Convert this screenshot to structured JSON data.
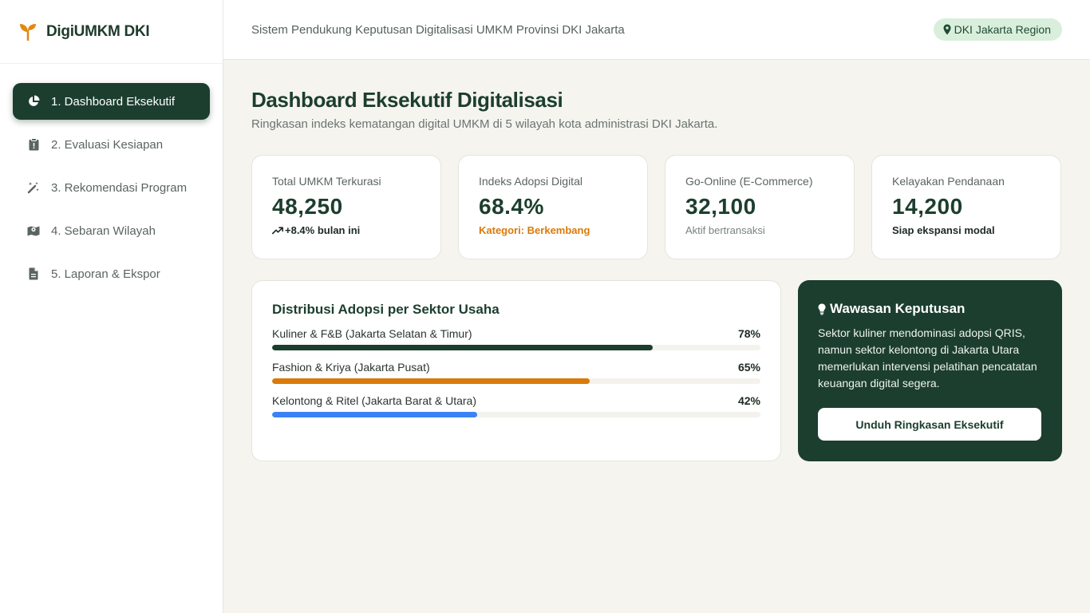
{
  "brand": {
    "name": "DigiUMKM DKI"
  },
  "sidebar": {
    "items": [
      {
        "label": "1. Dashboard Eksekutif",
        "icon": "pie-chart-icon",
        "active": true
      },
      {
        "label": "2. Evaluasi Kesiapan",
        "icon": "clipboard-icon",
        "active": false
      },
      {
        "label": "3. Rekomendasi Program",
        "icon": "magic-wand-icon",
        "active": false
      },
      {
        "label": "4. Sebaran Wilayah",
        "icon": "map-icon",
        "active": false
      },
      {
        "label": "5. Laporan & Ekspor",
        "icon": "document-icon",
        "active": false
      }
    ]
  },
  "header": {
    "title": "Sistem Pendukung Keputusan Digitalisasi UMKM Provinsi DKI Jakarta",
    "region": "DKI Jakarta Region"
  },
  "main": {
    "title": "Dashboard Eksekutif Digitalisasi",
    "subtitle": "Ringkasan indeks kematangan digital UMKM di 5 wilayah kota administrasi DKI Jakarta.",
    "kpis": [
      {
        "label": "Total UMKM Terkurasi",
        "value": "48,250",
        "note": "+8.4% bulan ini"
      },
      {
        "label": "Indeks Adopsi Digital",
        "value": "68.4%",
        "note": "Kategori: Berkembang"
      },
      {
        "label": "Go-Online (E-Commerce)",
        "value": "32,100",
        "note": "Aktif bertransaksi"
      },
      {
        "label": "Kelayakan Pendanaan",
        "value": "14,200",
        "note": "Siap ekspansi modal"
      }
    ],
    "distribution": {
      "title": "Distribusi Adopsi per Sektor Usaha",
      "rows": [
        {
          "label": "Kuliner & F&B (Jakarta Selatan & Timur)",
          "pct": "78%",
          "value": 78,
          "color": "#1c3e2e"
        },
        {
          "label": "Fashion & Kriya (Jakarta Pusat)",
          "pct": "65%",
          "value": 65,
          "color": "#d97a0a"
        },
        {
          "label": "Kelontong & Ritel (Jakarta Barat & Utara)",
          "pct": "42%",
          "value": 42,
          "color": "#3b82f6"
        }
      ]
    },
    "insight": {
      "title": "Wawasan Keputusan",
      "text": "Sektor kuliner mendominasi adopsi QRIS, namun sektor kelontong di Jakarta Utara memerlukan intervensi pelatihan pencatatan keuangan digital segera.",
      "button": "Unduh Ringkasan Eksekutif"
    }
  },
  "colors": {
    "primary": "#1c3e2e",
    "accent_orange": "#d97a0a",
    "accent_blue": "#3b82f6",
    "badge_bg": "#d9efdc"
  }
}
